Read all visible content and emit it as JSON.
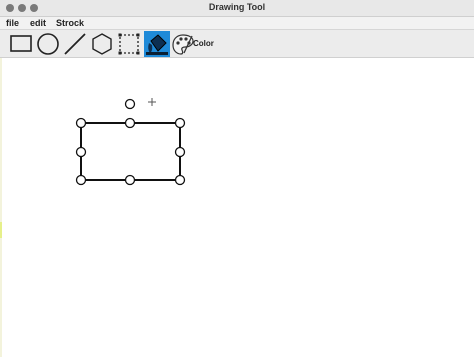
{
  "window": {
    "title": "Drawing Tool"
  },
  "menu": {
    "items": [
      "file",
      "edit",
      "Strock"
    ]
  },
  "toolbar": {
    "tools": [
      {
        "name": "rectangle-tool",
        "icon": "rectangle-icon"
      },
      {
        "name": "ellipse-tool",
        "icon": "circle-icon"
      },
      {
        "name": "line-tool",
        "icon": "line-icon"
      },
      {
        "name": "polygon-tool",
        "icon": "hexagon-icon"
      },
      {
        "name": "select-tool",
        "icon": "dashed-selection-icon"
      },
      {
        "name": "fill-tool",
        "icon": "paint-bucket-icon"
      },
      {
        "name": "palette-tool",
        "icon": "palette-icon"
      }
    ],
    "color_label": "Color",
    "accent": "#1f8ad8"
  },
  "canvas": {
    "shapes": [
      {
        "type": "rectangle",
        "selected": true,
        "has_rotation_handle": true,
        "cursor": "crosshair"
      }
    ]
  }
}
